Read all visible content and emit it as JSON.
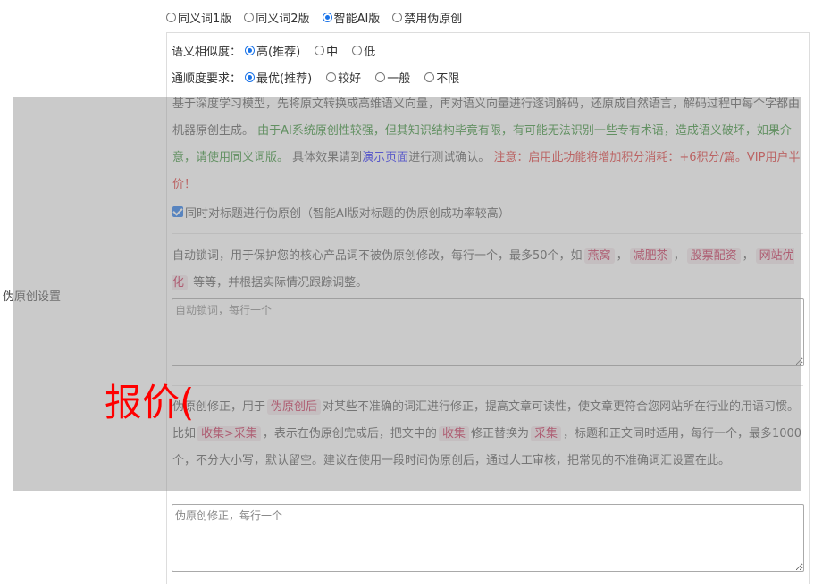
{
  "versions": [
    {
      "label": "同义词1版",
      "checked": false
    },
    {
      "label": "同义词2版",
      "checked": false
    },
    {
      "label": "智能AI版",
      "checked": true
    },
    {
      "label": "禁用伪原创",
      "checked": false
    }
  ],
  "side_label": "伪原创设置",
  "similarity": {
    "label": "语义相似度：",
    "options": [
      "高(推荐)",
      "中",
      "低"
    ]
  },
  "fluency": {
    "label": "通顺度要求：",
    "options": [
      "最优(推荐)",
      "较好",
      "一般",
      "不限"
    ]
  },
  "ai_desc": {
    "part1": "基于深度学习模型，先将原文转换成高维语义向量，再对语义向量进行逐词解码，还原成自然语言，解码过程中每个字都由机器原创生成。",
    "part2": "由于AI系统原创性较强，但其知识结构毕竟有限，有可能无法识别一些专有术语，造成语义破坏，如果介意，请使用同义词版。",
    "part3": "具体效果请到",
    "link": "演示页面",
    "part4": "进行测试确认。",
    "part5": "注意：启用此功能将增加积分消耗：+6积分/篇。VIP用户半价！"
  },
  "title_checkbox": {
    "label": "同时对标题进行伪原创（智能AI版对标题的伪原创成功率较高）",
    "checked": true
  },
  "lock_words": {
    "intro": "自动锁词，用于保护您的核心产品词不被伪原创修改，每行一个，最多50个，如",
    "examples": [
      "燕窝",
      "减肥茶",
      "股票配资",
      "网站优化"
    ],
    "sep": "，",
    "outro": "等等，并根据实际情况跟踪调整。",
    "placeholder": "自动锁词，每行一个"
  },
  "correction": {
    "intro": "伪原创修正，用于",
    "code1": "伪原创后",
    "text1": "对某些不准确的词汇进行修正，提高文章可读性，使文章更符合您网站所在行业的用语习惯。比如",
    "code2": "收集>采集",
    "text2": "，表示在伪原创完成后，把文中的",
    "code3": "收集",
    "text3": "修正替换为",
    "code4": "采集",
    "text4": "，标题和正文同时适用，每行一个，最多1000个，不分大小写，默认留空。建议在使用一段时间伪原创后，通过人工审核，把常见的不准确词汇设置在此。",
    "placeholder": "伪原创修正，每行一个"
  },
  "stamp_text": "报价("
}
